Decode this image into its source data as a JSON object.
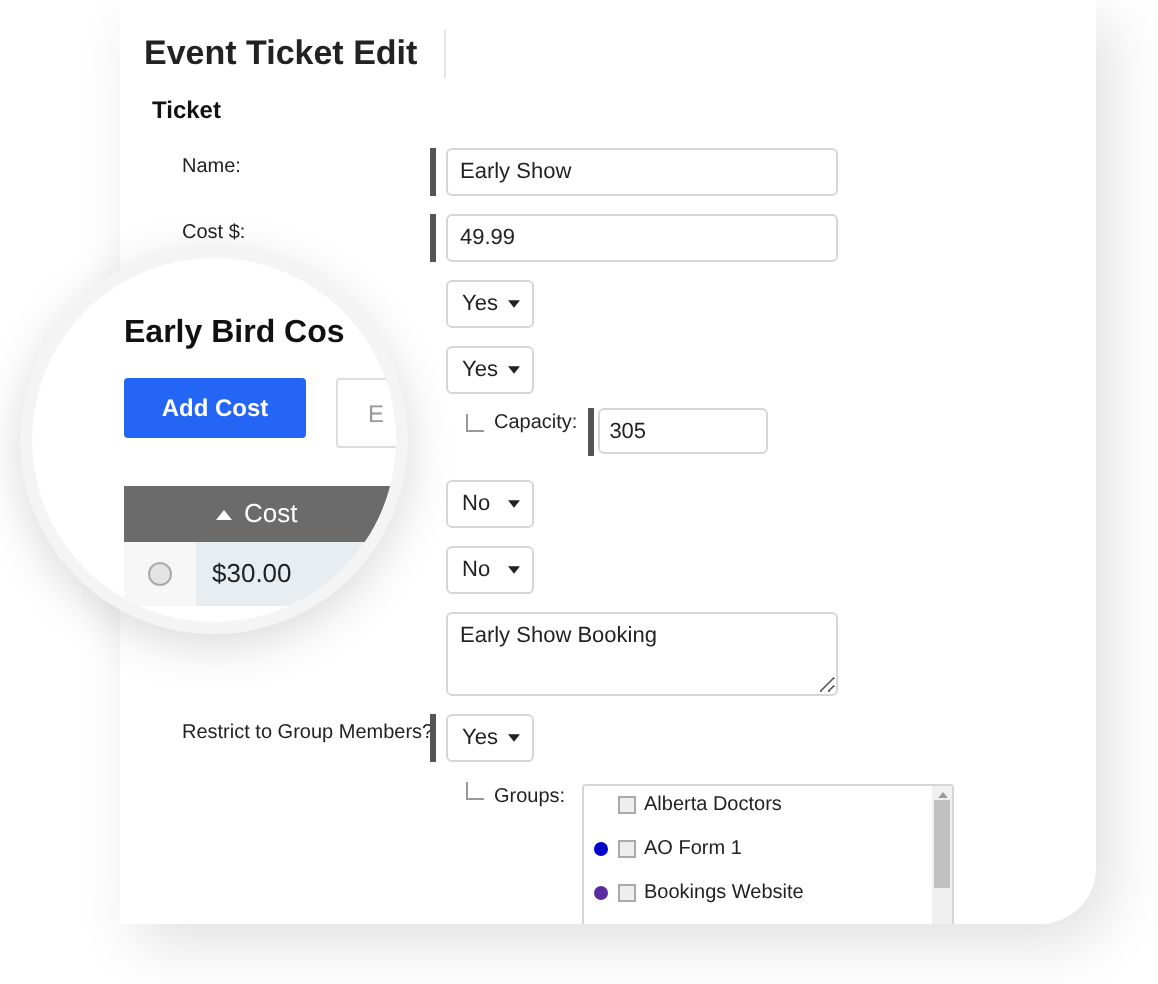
{
  "title": "Event Ticket Edit",
  "section": "Ticket",
  "rows": [
    {
      "kind": "text",
      "label": "Name:",
      "value": "Early Show",
      "required": true
    },
    {
      "kind": "text",
      "label": "Cost $:",
      "value": "49.99",
      "required": true
    },
    {
      "kind": "select",
      "value": "Yes",
      "required": false
    },
    {
      "kind": "select",
      "value": "Yes",
      "required": false
    },
    {
      "kind": "subtext",
      "label": "Capacity:",
      "value": "305",
      "required": true
    },
    {
      "kind": "select",
      "value": "No",
      "required": false
    },
    {
      "kind": "select",
      "value": "No",
      "required": false
    },
    {
      "kind": "textarea",
      "value": "Early Show Booking",
      "required": false
    },
    {
      "kind": "select",
      "label": "Restrict to Group Members?",
      "value": "Yes",
      "required": true
    },
    {
      "kind": "groups",
      "label": "Groups:",
      "items": [
        {
          "label": "Alberta Doctors",
          "checked": false
        },
        {
          "label": "AO Form 1",
          "checked": false,
          "color": "#0000cc"
        },
        {
          "label": "Bookings Website",
          "checked": false,
          "color": "#5b2a9e"
        }
      ]
    }
  ],
  "magnifier": {
    "heading": "Early Bird Cos",
    "buttons": [
      {
        "label": "Add Cost",
        "kind": "primary"
      },
      {
        "label": "E",
        "kind": "secondary"
      }
    ],
    "column": "Cost",
    "rows": [
      {
        "value": "$30.00",
        "selected": false
      }
    ]
  }
}
